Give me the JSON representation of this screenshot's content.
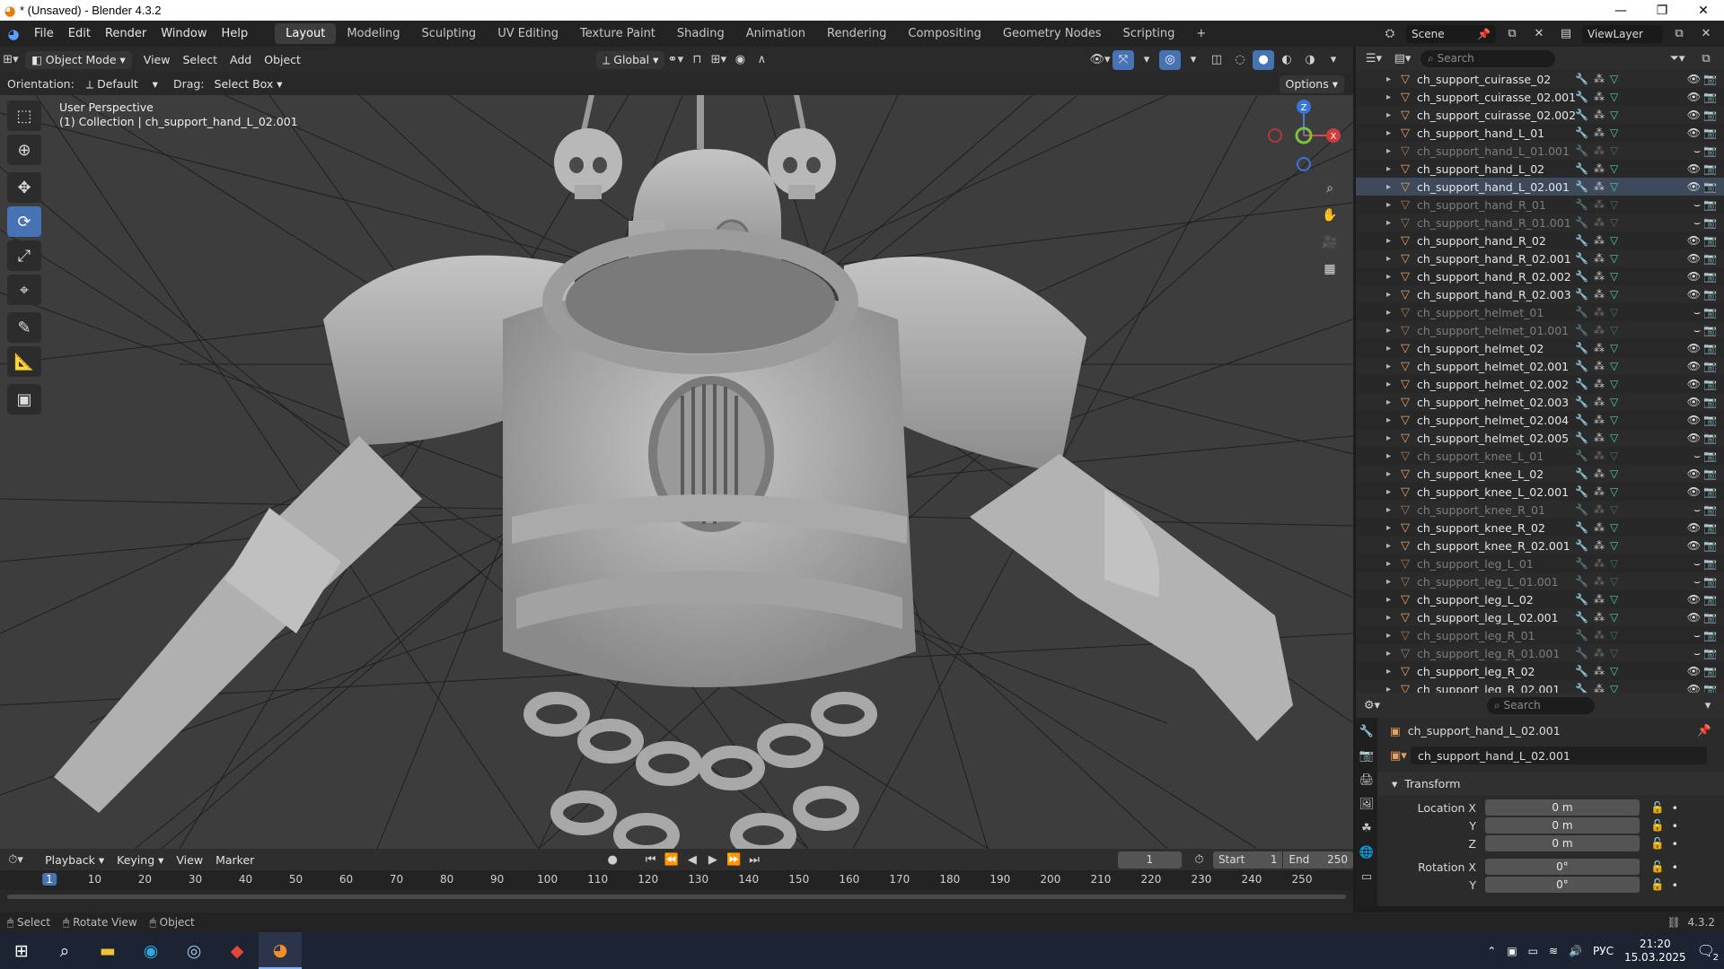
{
  "window": {
    "title": "* (Unsaved) - Blender 4.3.2",
    "controls": [
      "—",
      "❐",
      "✕"
    ]
  },
  "menu": [
    "File",
    "Edit",
    "Render",
    "Window",
    "Help"
  ],
  "workspaces": [
    "Layout",
    "Modeling",
    "Sculpting",
    "UV Editing",
    "Texture Paint",
    "Shading",
    "Animation",
    "Rendering",
    "Compositing",
    "Geometry Nodes",
    "Scripting"
  ],
  "active_workspace": "Layout",
  "scene": "Scene",
  "view_layer": "ViewLayer",
  "viewport_header": {
    "mode": "Object Mode",
    "menus": [
      "View",
      "Select",
      "Add",
      "Object"
    ],
    "transform": "Global",
    "orientation_label": "Orientation:",
    "orientation_value": "Default",
    "drag_label": "Drag:",
    "drag_value": "Select Box",
    "options": "Options"
  },
  "viewport_info": {
    "perspective": "User Perspective",
    "collection": "(1) Collection | ch_support_hand_L_02.001"
  },
  "gizmo": {
    "z": "Z",
    "x": "X"
  },
  "outliner": {
    "search_placeholder": "Search",
    "items": [
      {
        "name": "ch_support_cuirasse_02",
        "dim": false,
        "sel": false
      },
      {
        "name": "ch_support_cuirasse_02.001",
        "dim": false,
        "sel": false
      },
      {
        "name": "ch_support_cuirasse_02.002",
        "dim": false,
        "sel": false
      },
      {
        "name": "ch_support_hand_L_01",
        "dim": false,
        "sel": false
      },
      {
        "name": "ch_support_hand_L_01.001",
        "dim": true,
        "sel": false
      },
      {
        "name": "ch_support_hand_L_02",
        "dim": false,
        "sel": false
      },
      {
        "name": "ch_support_hand_L_02.001",
        "dim": false,
        "sel": true
      },
      {
        "name": "ch_support_hand_R_01",
        "dim": true,
        "sel": false
      },
      {
        "name": "ch_support_hand_R_01.001",
        "dim": true,
        "sel": false
      },
      {
        "name": "ch_support_hand_R_02",
        "dim": false,
        "sel": false
      },
      {
        "name": "ch_support_hand_R_02.001",
        "dim": false,
        "sel": false
      },
      {
        "name": "ch_support_hand_R_02.002",
        "dim": false,
        "sel": false
      },
      {
        "name": "ch_support_hand_R_02.003",
        "dim": false,
        "sel": false
      },
      {
        "name": "ch_support_helmet_01",
        "dim": true,
        "sel": false
      },
      {
        "name": "ch_support_helmet_01.001",
        "dim": true,
        "sel": false
      },
      {
        "name": "ch_support_helmet_02",
        "dim": false,
        "sel": false
      },
      {
        "name": "ch_support_helmet_02.001",
        "dim": false,
        "sel": false
      },
      {
        "name": "ch_support_helmet_02.002",
        "dim": false,
        "sel": false
      },
      {
        "name": "ch_support_helmet_02.003",
        "dim": false,
        "sel": false
      },
      {
        "name": "ch_support_helmet_02.004",
        "dim": false,
        "sel": false
      },
      {
        "name": "ch_support_helmet_02.005",
        "dim": false,
        "sel": false
      },
      {
        "name": "ch_support_knee_L_01",
        "dim": true,
        "sel": false
      },
      {
        "name": "ch_support_knee_L_02",
        "dim": false,
        "sel": false
      },
      {
        "name": "ch_support_knee_L_02.001",
        "dim": false,
        "sel": false
      },
      {
        "name": "ch_support_knee_R_01",
        "dim": true,
        "sel": false
      },
      {
        "name": "ch_support_knee_R_02",
        "dim": false,
        "sel": false
      },
      {
        "name": "ch_support_knee_R_02.001",
        "dim": false,
        "sel": false
      },
      {
        "name": "ch_support_leg_L_01",
        "dim": true,
        "sel": false
      },
      {
        "name": "ch_support_leg_L_01.001",
        "dim": true,
        "sel": false
      },
      {
        "name": "ch_support_leg_L_02",
        "dim": false,
        "sel": false
      },
      {
        "name": "ch_support_leg_L_02.001",
        "dim": false,
        "sel": false
      },
      {
        "name": "ch_support_leg_R_01",
        "dim": true,
        "sel": false
      },
      {
        "name": "ch_support_leg_R_01.001",
        "dim": true,
        "sel": false
      },
      {
        "name": "ch_support_leg_R_02",
        "dim": false,
        "sel": false
      },
      {
        "name": "ch_support_leg_R_02.001",
        "dim": false,
        "sel": false
      }
    ]
  },
  "properties": {
    "search_placeholder": "Search",
    "object_name": "ch_support_hand_L_02.001",
    "data_name": "ch_support_hand_L_02.001",
    "panel": "Transform",
    "rows": [
      {
        "label": "Location X",
        "value": "0 m"
      },
      {
        "label": "Y",
        "value": "0 m"
      },
      {
        "label": "Z",
        "value": "0 m"
      },
      {
        "label": "Rotation X",
        "value": "0°"
      },
      {
        "label": "Y",
        "value": "0°"
      }
    ]
  },
  "timeline": {
    "menus": [
      "Playback",
      "Keying",
      "View",
      "Marker"
    ],
    "current_frame": "1",
    "start_label": "Start",
    "start": "1",
    "end_label": "End",
    "end": "250",
    "ticks": [
      "1",
      "10",
      "20",
      "30",
      "40",
      "50",
      "60",
      "70",
      "80",
      "90",
      "100",
      "110",
      "120",
      "130",
      "140",
      "150",
      "160",
      "170",
      "180",
      "190",
      "200",
      "210",
      "220",
      "230",
      "240",
      "250"
    ]
  },
  "statusbar": {
    "select": "Select",
    "rotate": "Rotate View",
    "object": "Object",
    "version": "4.3.2"
  },
  "taskbar": {
    "lang": "РУС",
    "time": "21:20",
    "date": "15.03.2025",
    "notifications": "2"
  }
}
